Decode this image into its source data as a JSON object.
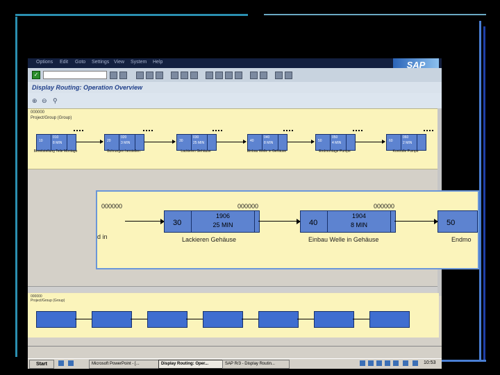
{
  "window": {
    "title": "Display Routing: Operation Overview",
    "brand": "SAP"
  },
  "menubar": {
    "items": [
      "Options",
      "Edit",
      "Goto",
      "Settings",
      "View",
      "System",
      "Help"
    ]
  },
  "toolbar": {
    "ok_icon": "enter-icon",
    "command_value": ""
  },
  "network_top": {
    "head1": "000000",
    "head2": "Project/Group (Group)",
    "ops": [
      {
        "num": "10",
        "c1": "010",
        "c2": "8 MIN",
        "label": "Bereitstellung Teile Montage"
      },
      {
        "num": "20",
        "c1": "020",
        "c2": "3 MIN",
        "label": "Bohrungen herstellen"
      },
      {
        "num": "30",
        "c1": "030",
        "c2": "25 MIN",
        "label": "Lackieren Gehäuse"
      },
      {
        "num": "40",
        "c1": "040",
        "c2": "8 MIN",
        "label": "Einbau Welle in Gehäuse"
      },
      {
        "num": "50",
        "c1": "050",
        "c2": "4 MIN",
        "label": "Endmontage Pumpe"
      },
      {
        "num": "60",
        "c1": "060",
        "c2": "2 MIN",
        "label": "Kontrolle Pumpe"
      }
    ]
  },
  "zoom": {
    "codes": [
      "000000",
      "000000",
      "000000"
    ],
    "ops": [
      {
        "num": "30",
        "c1": "1906",
        "c2": "25 MIN",
        "label": "Lackieren Gehäuse"
      },
      {
        "num": "40",
        "c1": "1904",
        "c2": "8 MIN",
        "label": "Einbau Welle in Gehäuse"
      },
      {
        "num": "50",
        "label": "Endmo"
      }
    ],
    "left_fragment": "d in"
  },
  "network_bottom": {
    "head1": "000000",
    "head2": "Project/Group (Group)"
  },
  "statusbar": {
    "text": ""
  },
  "taskbar": {
    "start": "Start",
    "tasks": [
      "Microsoft PowerPoint - [...",
      "Display Routing: Oper...",
      "SAP R/3 - Display Routin..."
    ],
    "clock": "10:53"
  }
}
